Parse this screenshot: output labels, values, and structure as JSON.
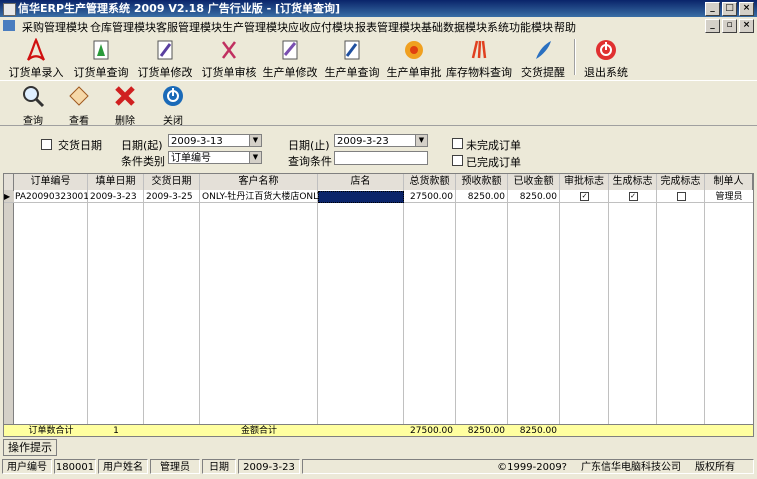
{
  "window": {
    "title": "信华ERP生产管理系统  2009 V2.18 广告行业版 - [订货单查询]"
  },
  "menu": [
    "采购管理模块",
    "仓库管理模块",
    "客服管理模块",
    "生产管理模块",
    "应收应付模块",
    "报表管理模块",
    "基础数据模块",
    "系统功能模块",
    "帮助"
  ],
  "toolbar_main": [
    "订货单录入",
    "订货单查询",
    "订货单修改",
    "订货单审核",
    "生产单修改",
    "生产单查询",
    "生产单审批",
    "库存物料查询",
    "交货提醒",
    "退出系统"
  ],
  "toolbar_actions": [
    "查询",
    "查看",
    "删除",
    "关闭"
  ],
  "filters": {
    "delivery_date_label": "交货日期",
    "date_start_label": "日期(起)",
    "date_start_value": "2009-3-13",
    "date_end_label": "日期(止)",
    "date_end_value": "2009-3-23",
    "unfinished_label": "未完成订单",
    "finished_label": "已完成订单",
    "condition_type_label": "条件类别",
    "condition_type_value": "订单编号",
    "query_condition_label": "查询条件"
  },
  "table": {
    "columns": [
      "订单编号",
      "填单日期",
      "交货日期",
      "客户名称",
      "店名",
      "总货款额",
      "预收款额",
      "已收金额",
      "审批标志",
      "生成标志",
      "完成标志",
      "制单人"
    ],
    "rows": [
      [
        "PA20090323001",
        "2009-3-23",
        "2009-3-25",
        "ONLY-牡丹江百货大楼店ONLY",
        "",
        "27500.00",
        "8250.00",
        "8250.00",
        "✓",
        "✓",
        "",
        "管理员"
      ]
    ],
    "footer": {
      "count_label": "订单数合计",
      "count_value": "1",
      "amount_label": "金额合计",
      "total": "27500.00",
      "prepaid": "8250.00",
      "received": "8250.00"
    }
  },
  "tabs": [
    "操作提示"
  ],
  "status": {
    "user_id_label": "用户编号",
    "user_id": "180001",
    "user_name_label": "用户姓名",
    "user_name": "管理员",
    "date_label": "日期",
    "date": "2009-3-23",
    "copyright": "©1999-2009?",
    "company": "广东信华电脑科技公司",
    "rights": "版权所有"
  }
}
